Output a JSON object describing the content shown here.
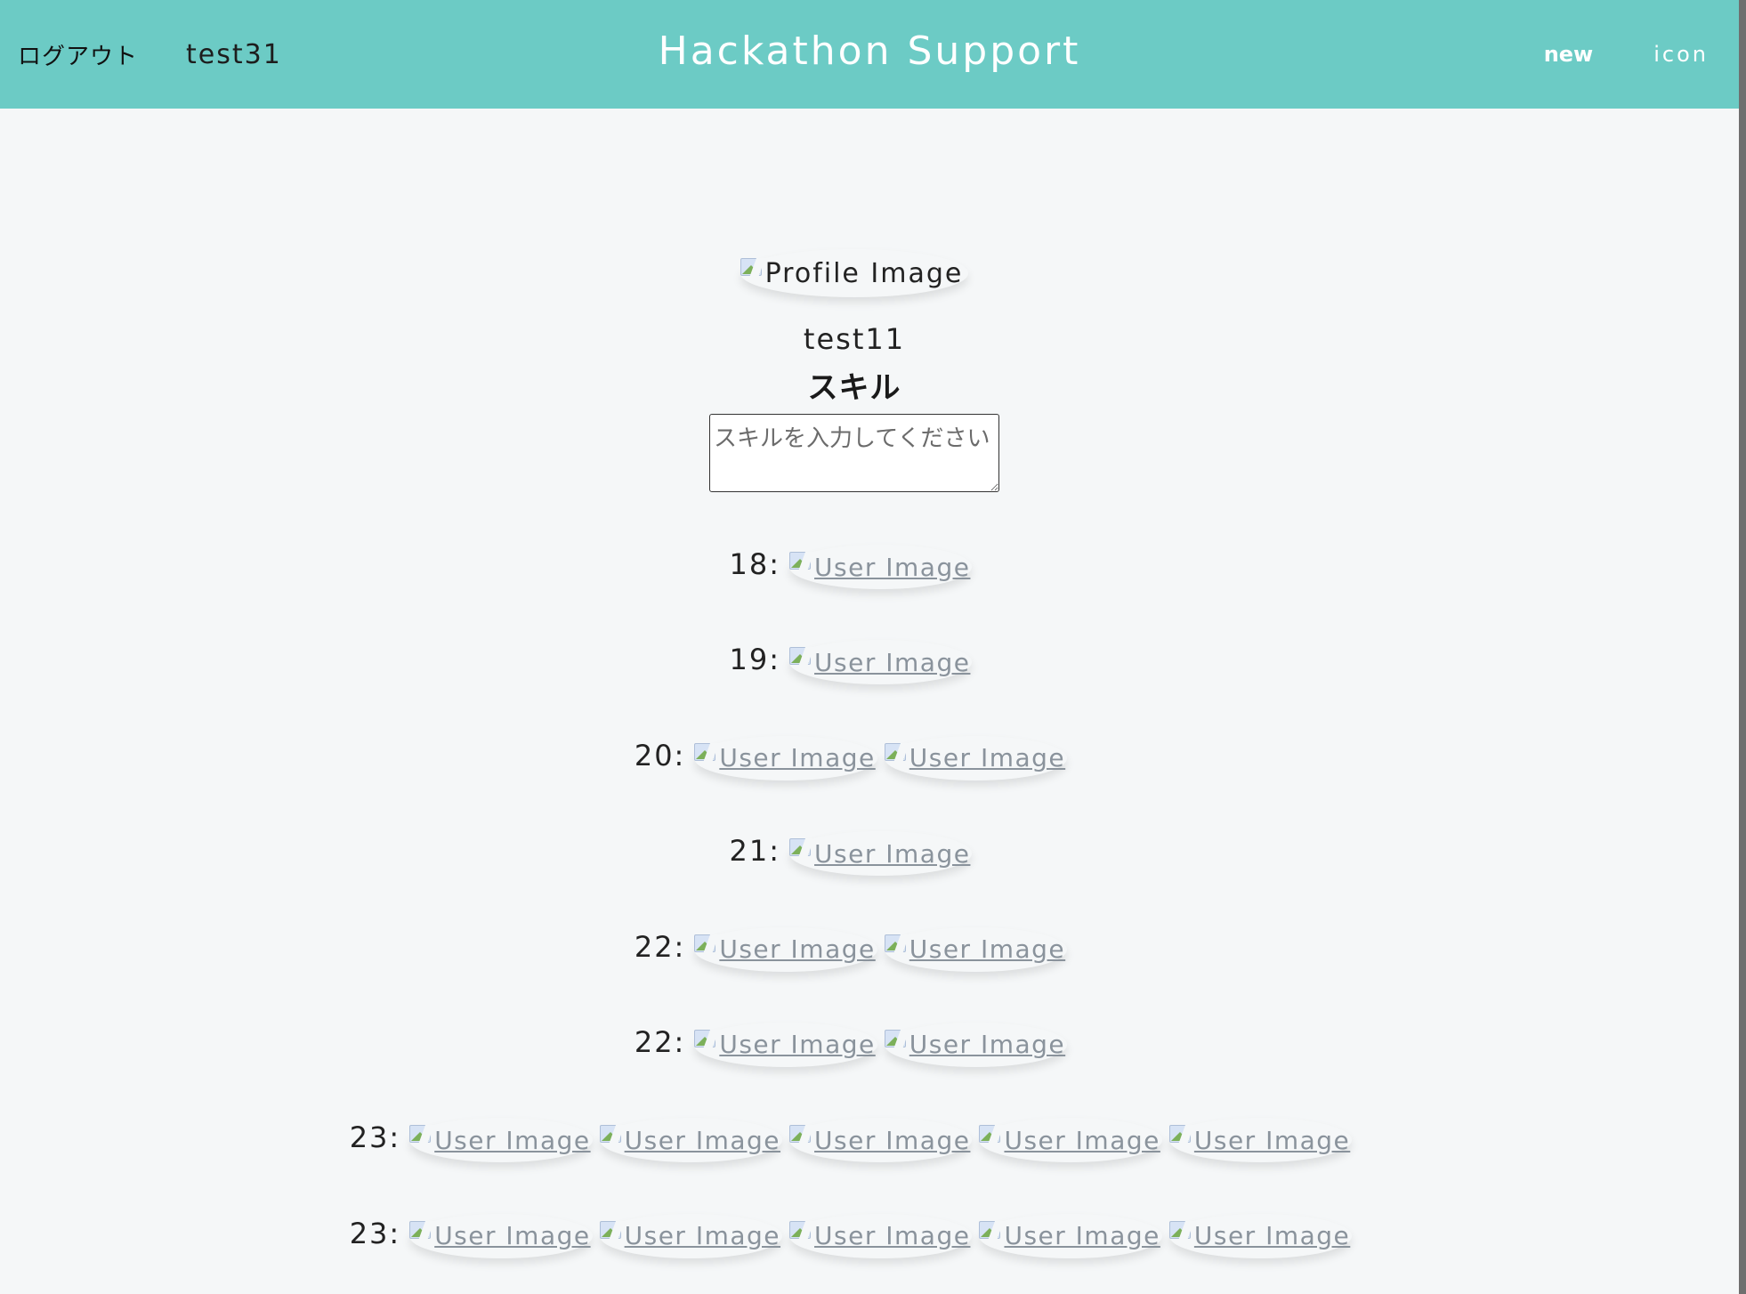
{
  "header": {
    "logout_label": "ログアウト",
    "username": "test31",
    "title": "Hackathon Support",
    "nav_new": "new",
    "nav_icon": "icon",
    "background_color": "#6ccbc5"
  },
  "profile": {
    "image_alt": "Profile Image",
    "name": "test11",
    "skill_heading": "スキル",
    "skill_placeholder": "スキルを入力してください",
    "skill_value": ""
  },
  "user_image_alt": "User Image",
  "days": [
    {
      "label": "18:",
      "user_count": 1
    },
    {
      "label": "19:",
      "user_count": 1
    },
    {
      "label": "20:",
      "user_count": 2
    },
    {
      "label": "21:",
      "user_count": 1
    },
    {
      "label": "22:",
      "user_count": 2
    },
    {
      "label": "22:",
      "user_count": 2
    },
    {
      "label": "23:",
      "user_count": 5
    },
    {
      "label": "23:",
      "user_count": 5
    }
  ]
}
